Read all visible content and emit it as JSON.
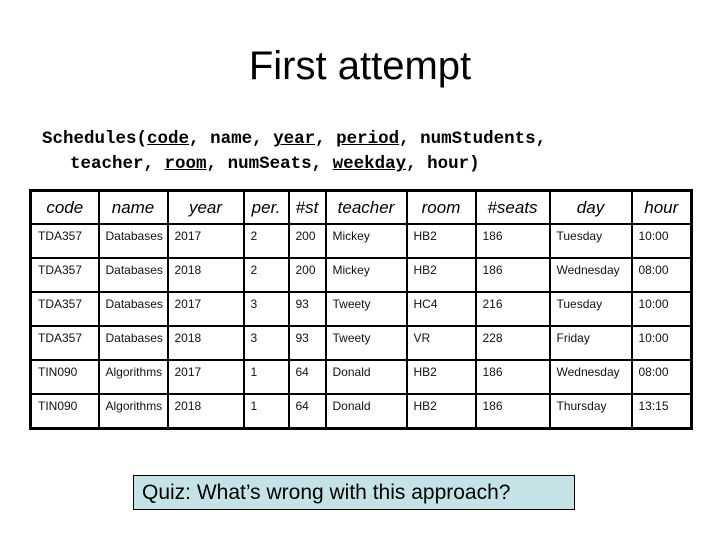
{
  "slide": {
    "title": "First attempt",
    "schema": {
      "relation": "Schedules",
      "attributes": [
        {
          "name": "code",
          "key": true
        },
        {
          "name": "name",
          "key": false
        },
        {
          "name": "year",
          "key": true
        },
        {
          "name": "period",
          "key": true
        },
        {
          "name": "numStudents",
          "key": false
        },
        {
          "name": "teacher",
          "key": false
        },
        {
          "name": "room",
          "key": true
        },
        {
          "name": "numSeats",
          "key": false
        },
        {
          "name": "weekday",
          "key": true
        },
        {
          "name": "hour",
          "key": false
        }
      ]
    },
    "table": {
      "headers": [
        "code",
        "name",
        "year",
        "per.",
        "#st",
        "teacher",
        "room",
        "#seats",
        "day",
        "hour"
      ],
      "rows": [
        [
          "TDA357",
          "Databases",
          "2017",
          "2",
          "200",
          "Mickey",
          "HB2",
          "186",
          "Tuesday",
          "10:00"
        ],
        [
          "TDA357",
          "Databases",
          "2018",
          "2",
          "200",
          "Mickey",
          "HB2",
          "186",
          "Wednesday",
          "08:00"
        ],
        [
          "TDA357",
          "Databases",
          "2017",
          "3",
          "93",
          "Tweety",
          "HC4",
          "216",
          "Tuesday",
          "10:00"
        ],
        [
          "TDA357",
          "Databases",
          "2018",
          "3",
          "93",
          "Tweety",
          "VR",
          "228",
          "Friday",
          "10:00"
        ],
        [
          "TIN090",
          "Algorithms",
          "2017",
          "1",
          "64",
          "Donald",
          "HB2",
          "186",
          "Wednesday",
          "08:00"
        ],
        [
          "TIN090",
          "Algorithms",
          "2018",
          "1",
          "64",
          "Donald",
          "HB2",
          "186",
          "Thursday",
          "13:15"
        ]
      ]
    },
    "quiz": "Quiz: What’s wrong with this approach?",
    "colors": {
      "quiz_background": "#c5e3e6"
    }
  }
}
